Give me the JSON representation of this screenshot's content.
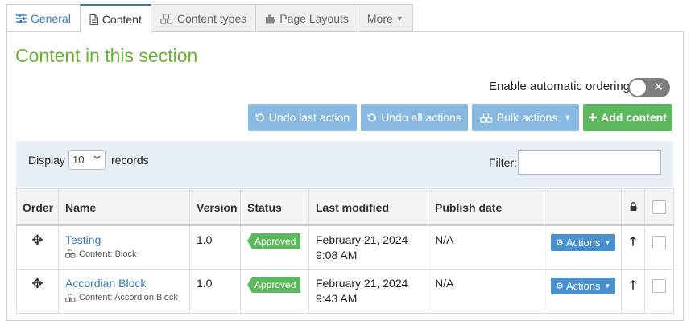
{
  "tabs": [
    {
      "label": "General",
      "icon": "sliders-icon"
    },
    {
      "label": "Content",
      "icon": "document-icon"
    },
    {
      "label": "Content types",
      "icon": "cubes-icon"
    },
    {
      "label": "Page Layouts",
      "icon": "puzzle-icon"
    },
    {
      "label": "More",
      "icon": "caret-down-icon"
    }
  ],
  "section_title": "Content in this section",
  "ordering": {
    "label": "Enable automatic ordering",
    "enabled": false
  },
  "toolbar": {
    "undo_last": "Undo last action",
    "undo_all": "Undo all actions",
    "bulk_actions": "Bulk actions",
    "add_content": "Add content"
  },
  "display": {
    "label": "Display",
    "value": "10",
    "suffix": "records"
  },
  "filter": {
    "label": "Filter:",
    "value": "",
    "placeholder": ""
  },
  "table": {
    "headers": {
      "order": "Order",
      "name": "Name",
      "version": "Version",
      "status": "Status",
      "last_modified": "Last modified",
      "publish_date": "Publish date"
    },
    "rows": [
      {
        "name": "Testing",
        "type": "Content: Block",
        "version": "1.0",
        "status": "Approved",
        "modified_date": "February 21, 2024",
        "modified_time": "9:08 AM",
        "publish_date": "N/A",
        "actions": "Actions"
      },
      {
        "name": "Accordian Block",
        "type": "Content: Accordion Block",
        "version": "1.0",
        "status": "Approved",
        "modified_date": "February 21, 2024",
        "modified_time": "9:43 AM",
        "publish_date": "N/A",
        "actions": "Actions"
      }
    ]
  },
  "colors": {
    "accent": "#337ab7",
    "title_green": "#6bb334",
    "approved": "#5cb85c",
    "button_light_blue": "#87b9e2"
  }
}
